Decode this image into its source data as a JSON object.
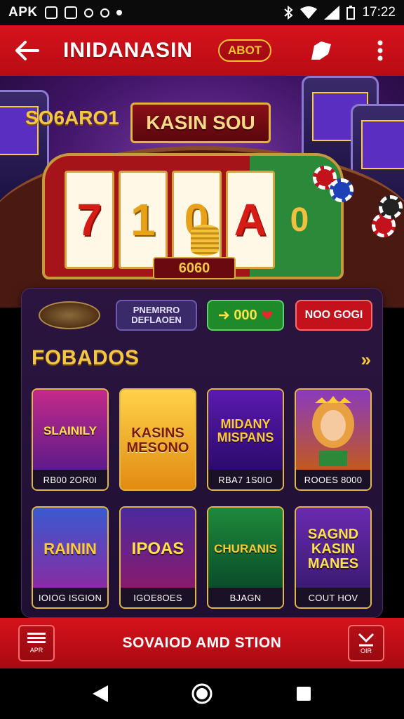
{
  "status": {
    "app": "APK",
    "time": "17:22"
  },
  "app_bar": {
    "title": "INIDANASIN",
    "about_label": "ABOT"
  },
  "hero": {
    "promo_text": "SO6ARO1",
    "banner_text": "KASIN SOU",
    "reels": [
      "7",
      "1",
      "0",
      "A",
      "0"
    ],
    "counter": "6060"
  },
  "panel": {
    "play_label": "PNEMRRO DEFLAOEN",
    "credit_value": "000",
    "bonus_label": "NOO GOGI",
    "section_title": "FOBADOS",
    "more_label": "»",
    "games": [
      {
        "art": "SLAINILY",
        "caption": "RB00 2OR0I"
      },
      {
        "art": "KASINS MESONO",
        "caption": ""
      },
      {
        "art": "MIDANY MISPANS",
        "caption": "RBA7 1S0IO"
      },
      {
        "art": "",
        "caption": "ROOES 8000"
      },
      {
        "art": "RAININ",
        "caption": "IOIOG ISGION"
      },
      {
        "art": "IPOAS",
        "caption": "IGOE8OES"
      },
      {
        "art": "CHURANIS",
        "caption": "BJAGN"
      },
      {
        "art": "SAGND KASIN MANES",
        "caption": "COUT HOV"
      }
    ]
  },
  "bottom_bar": {
    "title": "SOVAIOD AMD STION",
    "menu_label": "APR",
    "close_label": "OIR"
  },
  "colors": {
    "brand_red": "#d6121c",
    "gold": "#f3c645",
    "panel_purple": "#2b1540"
  }
}
